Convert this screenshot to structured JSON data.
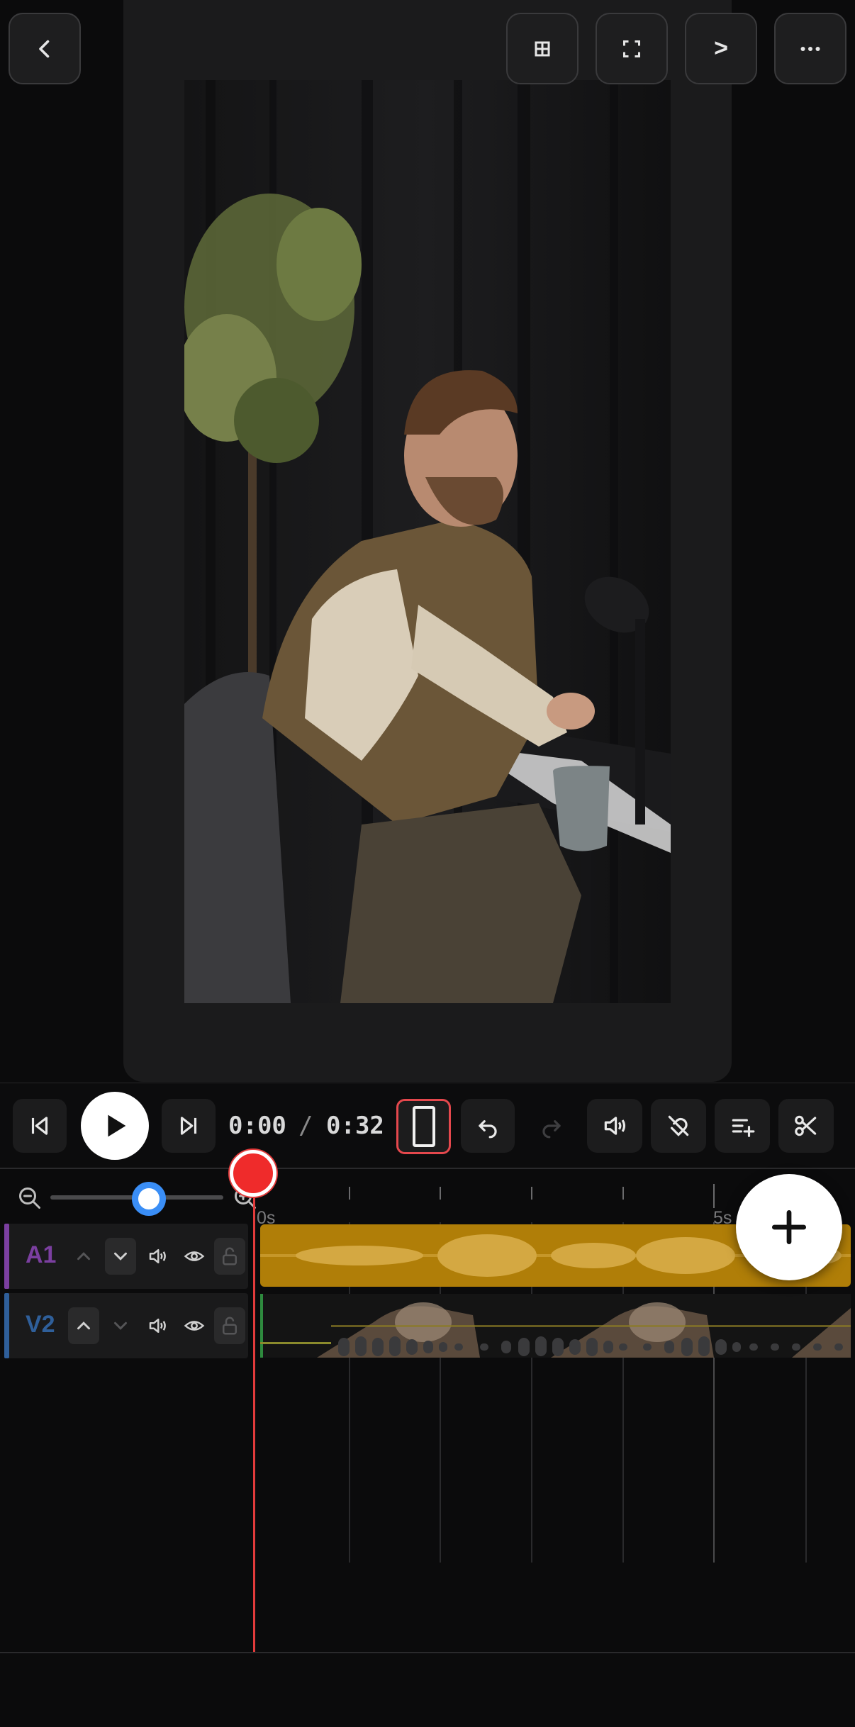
{
  "colors": {
    "background": "#0b0b0c",
    "preview_panel": "#1b1b1c",
    "track_a1": "#7b3fa0",
    "track_v2": "#2f5f9a",
    "audio_clip": "#b07e08",
    "playhead": "#e23b3b",
    "zoom_knob_ring": "#3a8ef6"
  },
  "top_bar": {
    "back_icon": "chevron-left-icon",
    "grid_icon": "grid-icon",
    "fullscreen_icon": "fullscreen-icon",
    "next_label": ">",
    "more_icon": "more-horizontal-icon"
  },
  "playback": {
    "current_time": "0:00",
    "separator": "/",
    "total_time": "0:32"
  },
  "toolbar": {
    "icons": [
      "skip-back-icon",
      "play-icon",
      "skip-forward-icon",
      "aspect-ratio-icon",
      "undo-icon",
      "redo-icon",
      "volume-icon",
      "magnet-icon",
      "add-list-icon",
      "scissors-icon"
    ]
  },
  "timeline": {
    "zoom_level": 0.6,
    "ruler_labels": [
      "0s",
      "5s"
    ],
    "tracks": [
      {
        "name": "A1",
        "color": "#7b3fa0"
      },
      {
        "name": "V2",
        "color": "#2f5f9a"
      }
    ]
  }
}
